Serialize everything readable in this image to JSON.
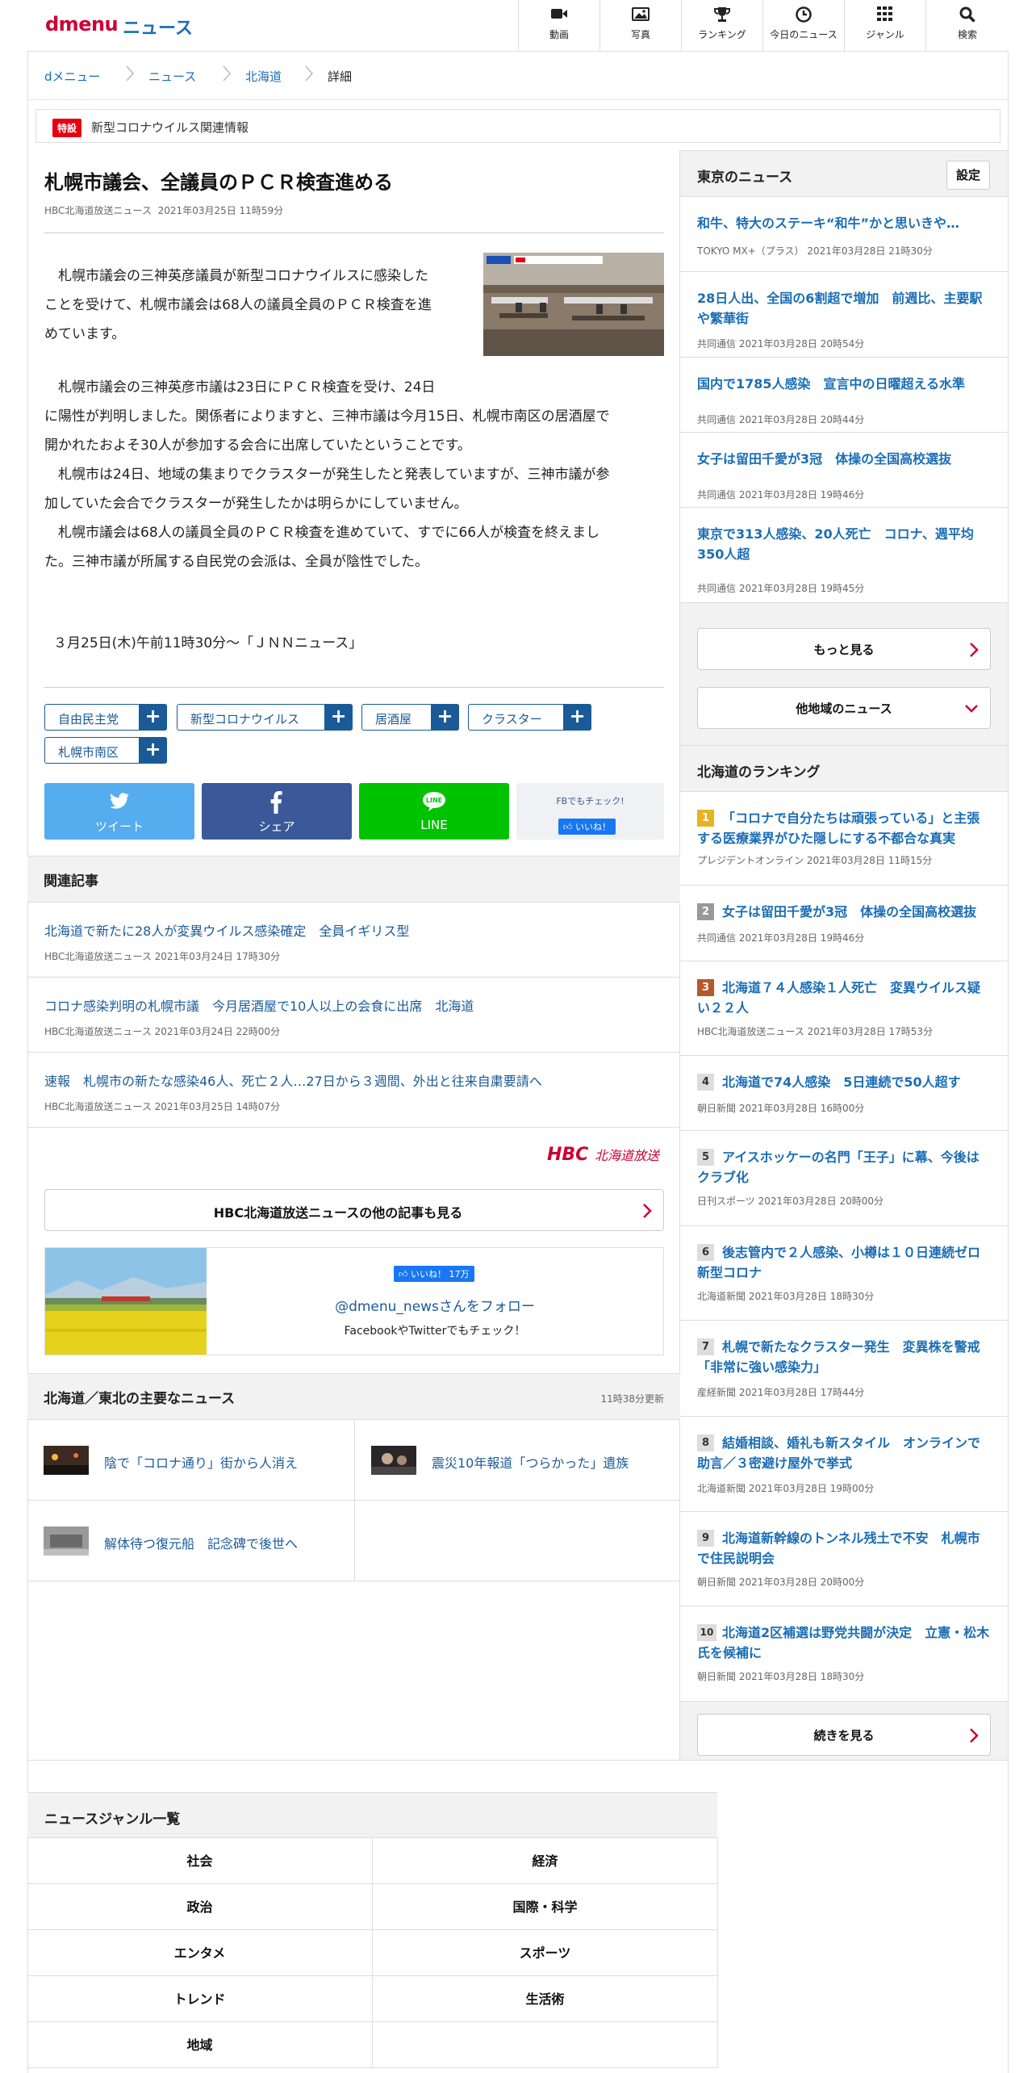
{
  "header": {
    "logo_d": "dmenu",
    "logo_news": "ニュース",
    "nav": [
      {
        "label": "動画",
        "icon": "video-icon"
      },
      {
        "label": "写真",
        "icon": "photo-icon"
      },
      {
        "label": "ランキング",
        "icon": "trophy-icon"
      },
      {
        "label": "今日のニュース",
        "icon": "clock-icon"
      },
      {
        "label": "ジャンル",
        "icon": "grid-icon"
      },
      {
        "label": "検索",
        "icon": "search-icon"
      }
    ]
  },
  "breadcrumb": [
    "dメニュー",
    "ニュース",
    "北海道",
    "詳細"
  ],
  "special": {
    "badge": "特設",
    "text": "新型コロナウイルス関連情報"
  },
  "article": {
    "title": "札幌市議会、全議員のＰＣＲ検査進める",
    "source": "HBC北海道放送ニュース",
    "date": "2021年03月25日 11時59分",
    "lead": [
      "　札幌市議会の三神英彦議員が新型コロナウイルスに感染した",
      "ことを受けて、札幌市議会は68人の議員全員のＰＣＲ検査を進",
      "めています。"
    ],
    "body": [
      "　札幌市議会の三神英彦市議は23日にＰＣＲ検査を受け、24日",
      "に陽性が判明しました。関係者によりますと、三神市議は今月15日、札幌市南区の居酒屋で",
      "開かれたおよそ30人が参加する会合に出席していたということです。",
      "　札幌市は24日、地域の集まりでクラスターが発生したと発表していますが、三神市議が参",
      "加していた会合でクラスターが発生したかは明らかにしていません。",
      "　札幌市議会は68人の議員全員のＰＣＲ検査を進めていて、すでに66人が検査を終えまし",
      "た。三神市議が所属する自民党の会派は、全員が陰性でした。"
    ],
    "broadcast": "３月25日(木)午前11時30分～「ＪＮＮニュース」",
    "tags": [
      "自由民主党",
      "新型コロナウイルス",
      "居酒屋",
      "クラスター",
      "札幌市南区"
    ],
    "share": {
      "tweet": "ツイート",
      "facebook": "シェア",
      "line": "LINE",
      "fb_check": "FBでもチェック!",
      "like": "いいね！"
    }
  },
  "related": {
    "heading": "関連記事",
    "items": [
      {
        "title": "北海道で新たに28人が変異ウイルス感染確定　全員イギリス型",
        "meta": "HBC北海道放送ニュース 2021年03月24日 17時30分"
      },
      {
        "title": "コロナ感染判明の札幌市議　今月居酒屋で10人以上の会食に出席　北海道",
        "meta": "HBC北海道放送ニュース 2021年03月24日 22時00分"
      },
      {
        "title": "速報　札幌市の新たな感染46人、死亡２人…27日から３週間、外出と往来自粛要請へ",
        "meta": "HBC北海道放送ニュース 2021年03月25日 14時07分"
      }
    ],
    "provider_logo": "HBC",
    "provider_logo_sub": "北海道放送",
    "more_label": "HBC北海道放送ニュースの他の記事も見る"
  },
  "follow": {
    "like_count": "いいね！ 17万",
    "handle": "@dmenu_newsさんをフォロー",
    "sub": "FacebookやTwitterでもチェック！"
  },
  "major": {
    "heading": "北海道／東北の主要なニュース",
    "updated": "11時38分更新",
    "items": [
      "陰で「コロナ通り」街から人消え",
      "震災10年報道「つらかった」遺族",
      "解体待つ復元船　記念碑で後世へ"
    ]
  },
  "tokyo": {
    "heading": "東京のニュース",
    "setting": "設定",
    "items": [
      {
        "title": "和牛、特大のステーキ“和牛”かと思いきや…",
        "meta": "TOKYO MX+（プラス） 2021年03月28日 21時30分"
      },
      {
        "title": "28日人出、全国の6割超で増加　前週比、主要駅や繁華街",
        "meta": "共同通信 2021年03月28日 20時54分"
      },
      {
        "title": "国内で1785人感染　宣言中の日曜超える水準",
        "meta": "共同通信 2021年03月28日 20時44分"
      },
      {
        "title": "女子は留田千愛が3冠　体操の全国高校選抜",
        "meta": "共同通信 2021年03月28日 19時46分"
      },
      {
        "title": "東京で313人感染、20人死亡　コロナ、週平均350人超",
        "meta": "共同通信 2021年03月28日 19時45分"
      }
    ],
    "more": "もっと見る",
    "other": "他地域のニュース"
  },
  "ranking": {
    "heading": "北海道のランキング",
    "items": [
      {
        "num": "1",
        "title": "「コロナで自分たちは頑張っている」と主張する医療業界がひた隠しにする不都合な真実",
        "meta": "プレジデントオンライン 2021年03月28日 11時15分"
      },
      {
        "num": "2",
        "title": "女子は留田千愛が3冠　体操の全国高校選抜",
        "meta": "共同通信 2021年03月28日 19時46分"
      },
      {
        "num": "3",
        "title": "北海道７４人感染１人死亡　変異ウイルス疑い２２人",
        "meta": "HBC北海道放送ニュース 2021年03月28日 17時53分"
      },
      {
        "num": "4",
        "title": "北海道で74人感染　5日連続で50人超す",
        "meta": "朝日新聞 2021年03月28日 16時00分"
      },
      {
        "num": "5",
        "title": "アイスホッケーの名門「王子」に幕、今後はクラブ化",
        "meta": "日刊スポーツ 2021年03月28日 20時00分"
      },
      {
        "num": "6",
        "title": "後志管内で２人感染、小樽は１０日連続ゼロ　新型コロナ",
        "meta": "北海道新聞 2021年03月28日 18時30分"
      },
      {
        "num": "7",
        "title": "札幌で新たなクラスター発生　変異株を警戒「非常に強い感染力」",
        "meta": "産経新聞 2021年03月28日 17時44分"
      },
      {
        "num": "8",
        "title": "結婚相談、婚礼も新スタイル　オンラインで助言／３密避け屋外で挙式",
        "meta": "北海道新聞 2021年03月28日 19時00分"
      },
      {
        "num": "9",
        "title": "北海道新幹線のトンネル残土で不安　札幌市で住民説明会",
        "meta": "朝日新聞 2021年03月28日 20時00分"
      },
      {
        "num": "10",
        "title": "北海道2区補選は野党共闘が決定　立憲・松木氏を候補に",
        "meta": "朝日新聞 2021年03月28日 18時30分"
      }
    ],
    "more": "続きを見る",
    "num_colors": {
      "1": "#e6b422",
      "2": "#999999",
      "3": "#b5592a",
      "other": "#dddddd"
    }
  },
  "genre": {
    "heading": "ニュースジャンル一覧",
    "items": [
      "社会",
      "経済",
      "政治",
      "国際・科学",
      "エンタメ",
      "スポーツ",
      "トレンド",
      "生活術",
      "地域",
      ""
    ]
  }
}
